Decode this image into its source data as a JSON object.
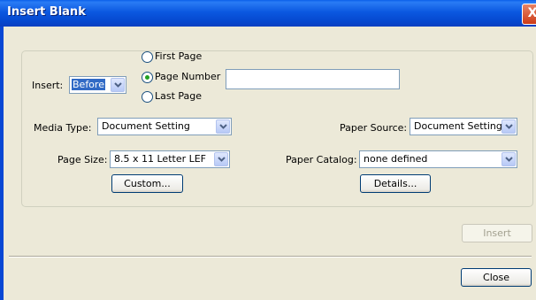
{
  "window": {
    "title": "Insert Blank",
    "close_glyph": "X"
  },
  "insert": {
    "label": "Insert:",
    "position_value": "Before",
    "options": [
      {
        "label": "First Page",
        "selected": false
      },
      {
        "label": "Page Number",
        "selected": true
      },
      {
        "label": "Last Page",
        "selected": false
      }
    ],
    "page_number_value": ""
  },
  "media_type": {
    "label": "Media Type:",
    "value": "Document Setting"
  },
  "paper_source": {
    "label": "Paper Source:",
    "value": "Document Setting"
  },
  "page_size": {
    "label": "Page Size:",
    "value": "8.5 x 11 Letter LEF"
  },
  "paper_catalog": {
    "label": "Paper Catalog:",
    "value": "none defined"
  },
  "buttons": {
    "custom": "Custom...",
    "details": "Details...",
    "insert": "Insert",
    "close": "Close"
  },
  "colors": {
    "title_bar": "#0b58e0",
    "dialog_face": "#ece9d8",
    "selection": "#316ac5"
  }
}
